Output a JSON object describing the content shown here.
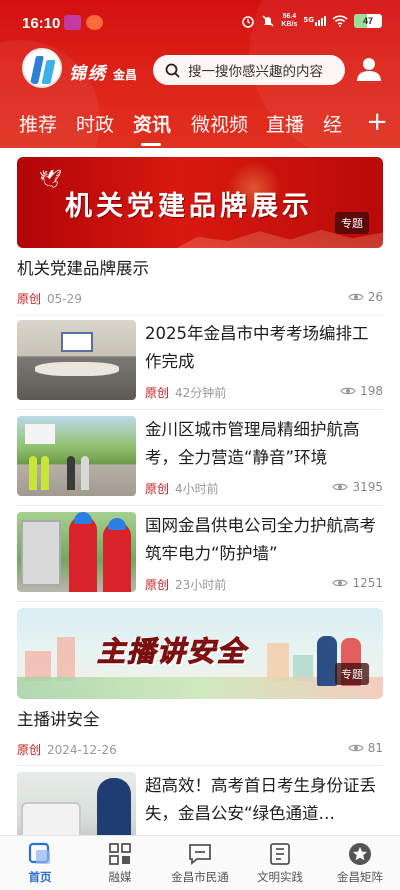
{
  "colors": {
    "brand_red": "#d3100f",
    "origin_red": "#c81a1a",
    "nav_active": "#2b6fd9"
  },
  "status_bar": {
    "time": "16:10",
    "network_speed": "56.4",
    "network_unit": "KB/s",
    "signal": "5G",
    "battery": "47"
  },
  "header": {
    "logo_icon": "jinchang-logo-icon",
    "brand_name": "锦绣金昌",
    "brand_main": "锦绣",
    "brand_sub": "金昌",
    "search_placeholder": "搜一搜你感兴趣的内容",
    "user_icon": "user-icon"
  },
  "tabs": [
    {
      "label": "推荐"
    },
    {
      "label": "时政"
    },
    {
      "label": "资讯",
      "active": true
    },
    {
      "label": "微视频"
    },
    {
      "label": "直播"
    },
    {
      "label": "经"
    }
  ],
  "tabs_add": "+",
  "feed": {
    "banner_1": {
      "image_text": "机关党建品牌展示",
      "tag": "专题",
      "title": "机关党建品牌展示",
      "origin": "原创",
      "time": "05-29",
      "views": "26"
    },
    "news": [
      {
        "title": "2025年金昌市中考考场编排工作完成",
        "origin": "原创",
        "time": "42分钟前",
        "views": "198"
      },
      {
        "title": "金川区城市管理局精细护航高考，全力营造“静音”环境",
        "origin": "原创",
        "time": "4小时前",
        "views": "3195"
      },
      {
        "title": "国网金昌供电公司全力护航高考 筑牢电力“防护墙”",
        "origin": "原创",
        "time": "23小时前",
        "views": "1251"
      }
    ],
    "banner_2": {
      "image_text": "主播讲安全",
      "tag": "专题",
      "title": "主播讲安全",
      "origin": "原创",
      "time": "2024-12-26",
      "views": "81"
    },
    "last_news": {
      "title": "超高效！高考首日考生身份证丢失，金昌公安“绿色通道…"
    }
  },
  "bottom_nav": [
    {
      "label": "首页",
      "icon": "home-icon",
      "active": true
    },
    {
      "label": "融媒",
      "icon": "grid-icon"
    },
    {
      "label": "金昌市民通",
      "icon": "message-icon"
    },
    {
      "label": "文明实践",
      "icon": "document-icon"
    },
    {
      "label": "金昌矩阵",
      "icon": "star-icon"
    }
  ]
}
